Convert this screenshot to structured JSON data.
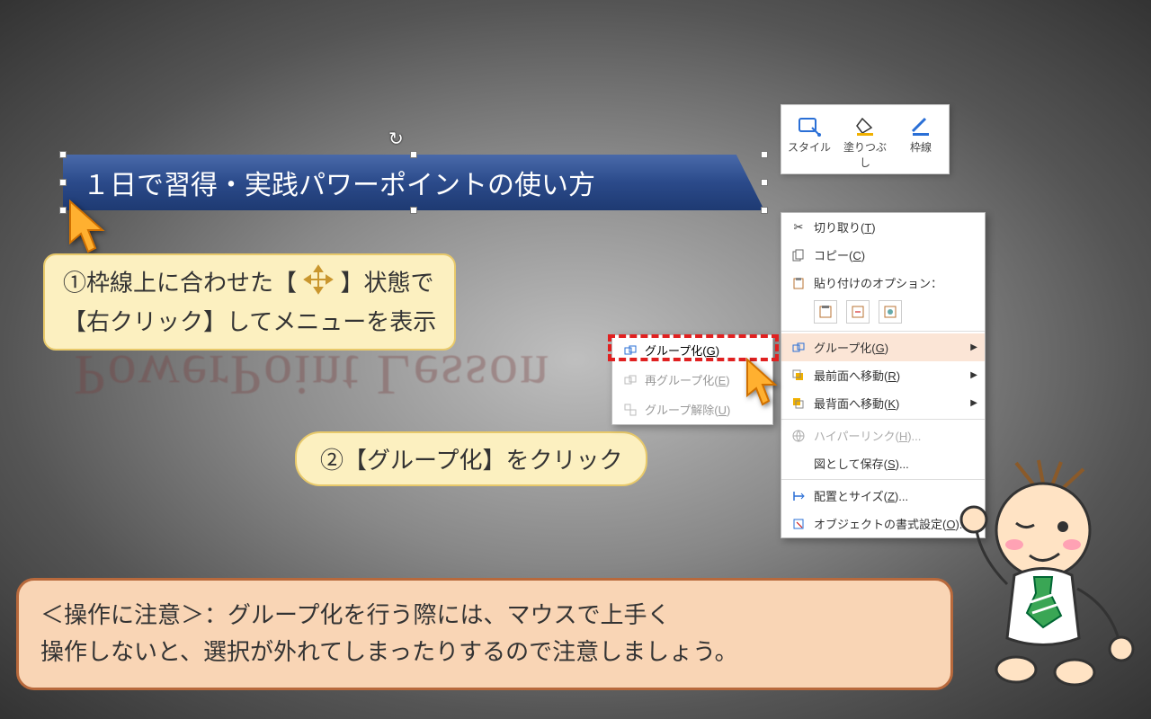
{
  "banner": {
    "title": "１日で習得・実践パワーポイントの使い方"
  },
  "callout1": {
    "line1a": "①枠線上に合わせた【",
    "line1b": "】状態で",
    "line2": "【右クリック】してメニューを表示"
  },
  "callout2": {
    "text": "②【グループ化】をクリック"
  },
  "reflect_text": "PowerPoint Lesson",
  "mini_toolbar": {
    "style": "スタイル",
    "fill": "塗りつぶし",
    "outline": "枠線"
  },
  "context_menu": {
    "cut": "切り取り(",
    "cut_u": "T",
    "cut_end": ")",
    "copy": "コピー(",
    "copy_u": "C",
    "copy_end": ")",
    "paste_opts": "貼り付けのオプション：",
    "group": "グループ化(",
    "group_u": "G",
    "group_end": ")",
    "bring_front": "最前面へ移動(",
    "bring_front_u": "R",
    "bring_front_end": ")",
    "send_back": "最背面へ移動(",
    "send_back_u": "K",
    "send_back_end": ")",
    "hyperlink": "ハイパーリンク(",
    "hyperlink_u": "H",
    "hyperlink_end": ")...",
    "save_img": "図として保存(",
    "save_img_u": "S",
    "save_img_end": ")...",
    "size_pos": "配置とサイズ(",
    "size_pos_u": "Z",
    "size_pos_end": ")...",
    "format_obj": "オブジェクトの書式設定(",
    "format_obj_u": "O",
    "format_obj_end": ")..."
  },
  "submenu": {
    "group": "グループ化(",
    "group_u": "G",
    "group_end": ")",
    "regroup": "再グループ化(",
    "regroup_u": "E",
    "regroup_end": ")",
    "ungroup": "グループ解除(",
    "ungroup_u": "U",
    "ungroup_end": ")"
  },
  "note": {
    "line1": "＜操作に注意＞：グループ化を行う際には、マウスで上手く",
    "line2": "操作しないと、選択が外れてしまったりするので注意しましょう。"
  }
}
